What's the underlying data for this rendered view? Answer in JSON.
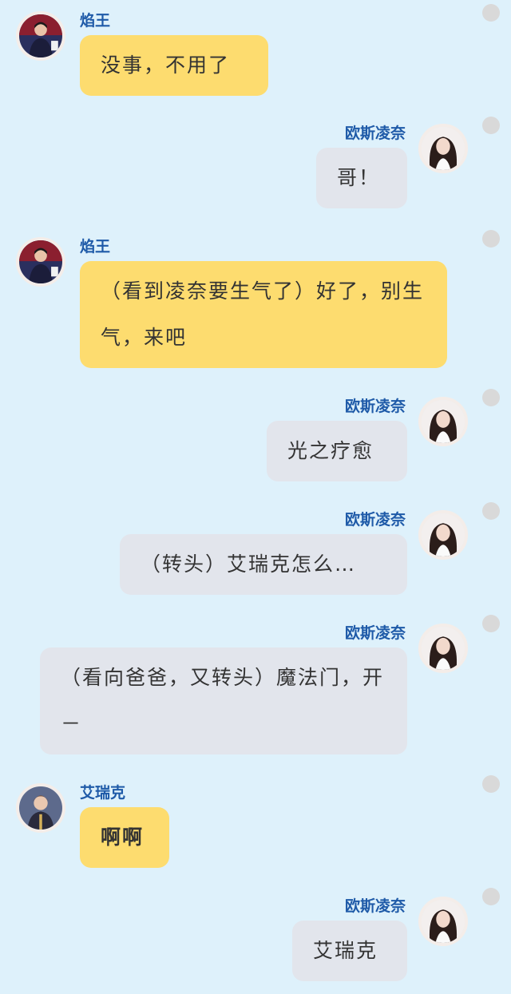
{
  "messages": [
    {
      "side": "left",
      "name": "焰王",
      "avatar": "yanwang-avatar",
      "text": "没事，不用了"
    },
    {
      "side": "right",
      "name": "欧斯凌奈",
      "avatar": "ousilingnai-avatar",
      "text": "哥！"
    },
    {
      "side": "left",
      "name": "焰王",
      "avatar": "yanwang-avatar",
      "text": "（看到凌奈要生气了）好了，别生气，来吧"
    },
    {
      "side": "right",
      "name": "欧斯凌奈",
      "avatar": "ousilingnai-avatar",
      "text": "光之疗愈"
    },
    {
      "side": "right",
      "name": "欧斯凌奈",
      "avatar": "ousilingnai-avatar",
      "text": "（转头）艾瑞克怎么…"
    },
    {
      "side": "right",
      "name": "欧斯凌奈",
      "avatar": "ousilingnai-avatar",
      "text": "（看向爸爸，又转头）魔法门，开－"
    },
    {
      "side": "left",
      "name": "艾瑞克",
      "avatar": "airuike-avatar",
      "text": "啊啊"
    },
    {
      "side": "right",
      "name": "欧斯凌奈",
      "avatar": "ousilingnai-avatar",
      "text": "艾瑞克"
    }
  ],
  "colors": {
    "background": "#def1fb",
    "left_bubble": "#fddc6f",
    "right_bubble": "#e2e5ec",
    "name": "#1e5aa8"
  }
}
